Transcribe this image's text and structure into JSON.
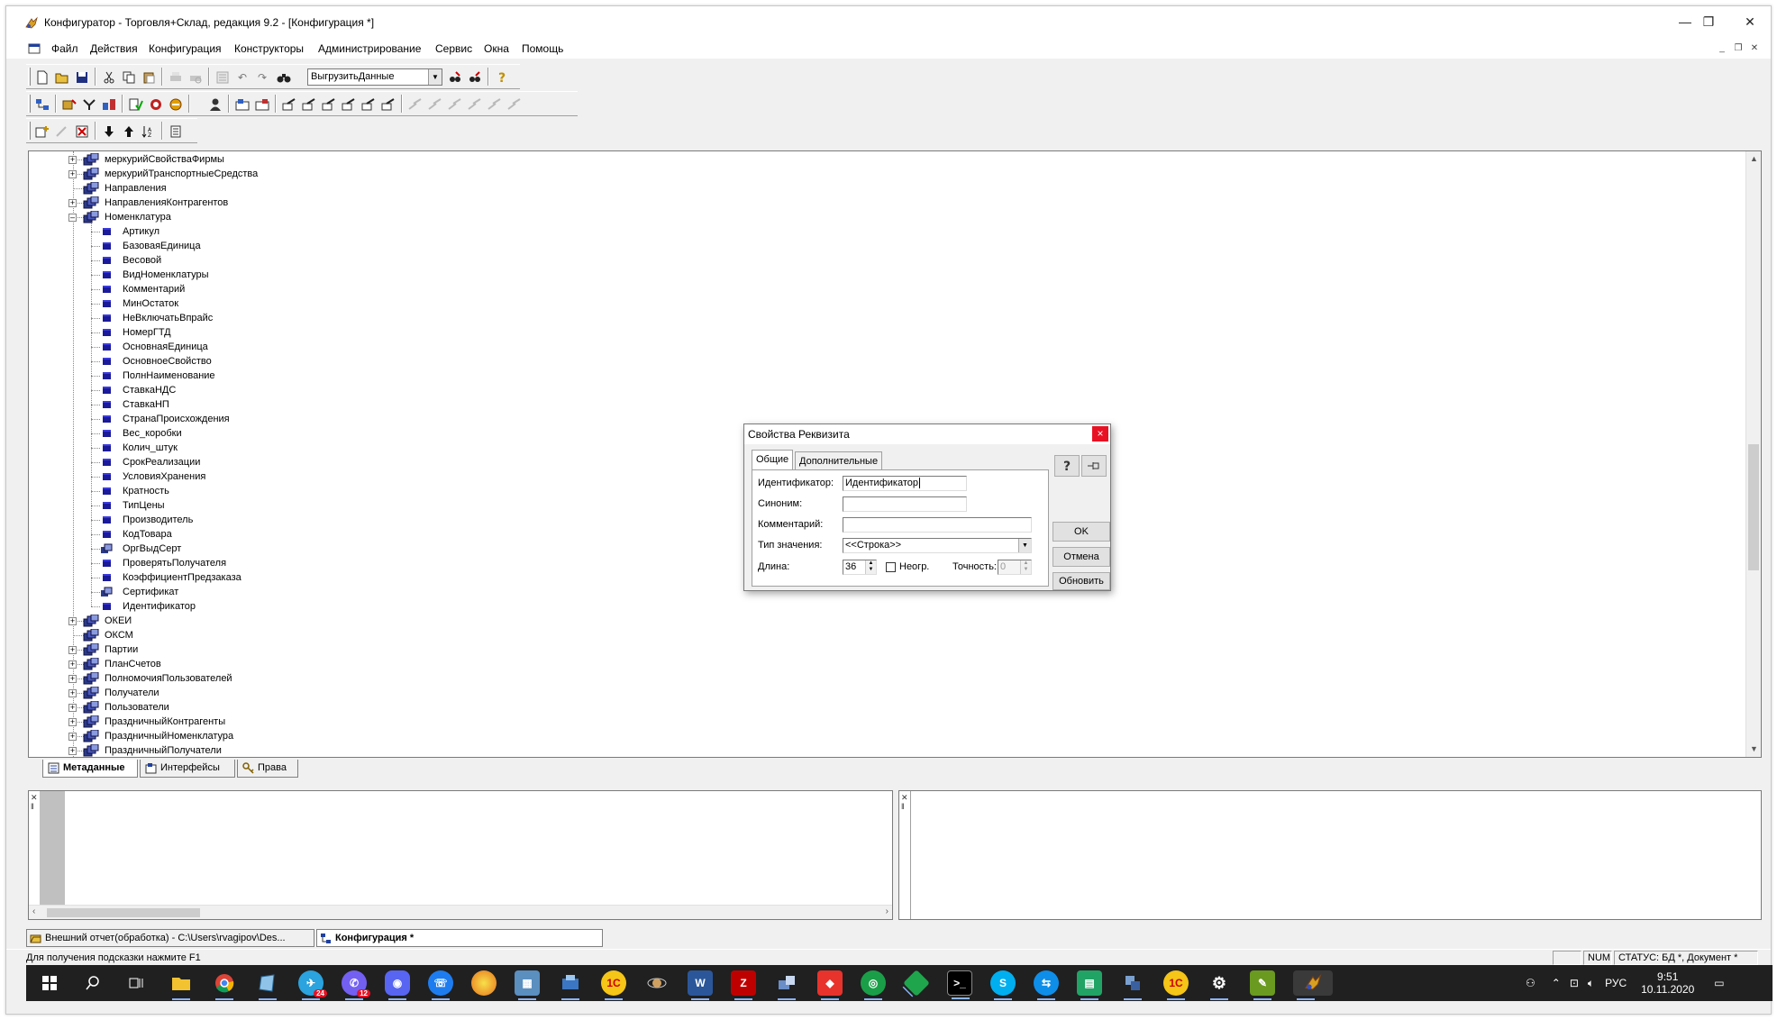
{
  "window": {
    "title": "Конфигуратор - Торговля+Склад, редакция 9.2 - [Конфигурация *]",
    "minimize": "—",
    "maximize": "❐",
    "close": "✕"
  },
  "menu": [
    "Файл",
    "Действия",
    "Конфигурация",
    "Конструкторы",
    "Администрирование",
    "Сервис",
    "Окна",
    "Помощь"
  ],
  "toolbar": {
    "combo_value": "ВыгрузитьДанные"
  },
  "tree": {
    "items": [
      {
        "label": "меркурийСвойстваФирмы",
        "level": 1,
        "expander": "+"
      },
      {
        "label": "меркурийТранспортныеСредства",
        "level": 1,
        "expander": "+"
      },
      {
        "label": "Направления",
        "level": 1,
        "expander": ""
      },
      {
        "label": "НаправленияКонтрагентов",
        "level": 1,
        "expander": "+"
      },
      {
        "label": "Номенклатура",
        "level": 1,
        "expander": "−"
      },
      {
        "label": "Артикул",
        "level": 2
      },
      {
        "label": "БазоваяЕдиница",
        "level": 2
      },
      {
        "label": "Весовой",
        "level": 2
      },
      {
        "label": "ВидНоменклатуры",
        "level": 2
      },
      {
        "label": "Комментарий",
        "level": 2
      },
      {
        "label": "МинОстаток",
        "level": 2
      },
      {
        "label": "НеВключатьВпрайс",
        "level": 2
      },
      {
        "label": "НомерГТД",
        "level": 2
      },
      {
        "label": "ОсновнаяЕдиница",
        "level": 2
      },
      {
        "label": "ОсновноеСвойство",
        "level": 2
      },
      {
        "label": "ПолнНаименование",
        "level": 2
      },
      {
        "label": "СтавкаНДС",
        "level": 2
      },
      {
        "label": "СтавкаНП",
        "level": 2
      },
      {
        "label": "СтранаПроисхождения",
        "level": 2
      },
      {
        "label": "Вес_коробки",
        "level": 2
      },
      {
        "label": "Колич_штук",
        "level": 2
      },
      {
        "label": "СрокРеализации",
        "level": 2
      },
      {
        "label": "УсловияХранения",
        "level": 2
      },
      {
        "label": "Кратность",
        "level": 2
      },
      {
        "label": "ТипЦены",
        "level": 2
      },
      {
        "label": "Производитель",
        "level": 2
      },
      {
        "label": "КодТовара",
        "level": 2
      },
      {
        "label": "ОргВыдСерт",
        "level": 2,
        "alt": true
      },
      {
        "label": "ПроверятьПолучателя",
        "level": 2
      },
      {
        "label": "КоэффициентПредзаказа",
        "level": 2
      },
      {
        "label": "Сертификат",
        "level": 2,
        "alt": true
      },
      {
        "label": "Идентификатор",
        "level": 2
      },
      {
        "label": "ОКЕИ",
        "level": 1,
        "expander": "+"
      },
      {
        "label": "ОКСМ",
        "level": 1,
        "expander": ""
      },
      {
        "label": "Партии",
        "level": 1,
        "expander": "+"
      },
      {
        "label": "ПланСчетов",
        "level": 1,
        "expander": "+"
      },
      {
        "label": "ПолномочияПользователей",
        "level": 1,
        "expander": "+"
      },
      {
        "label": "Получатели",
        "level": 1,
        "expander": "+"
      },
      {
        "label": "Пользователи",
        "level": 1,
        "expander": "+"
      },
      {
        "label": "ПраздничныйКонтрагенты",
        "level": 1,
        "expander": "+"
      },
      {
        "label": "ПраздничныйНоменклатура",
        "level": 1,
        "expander": "+"
      },
      {
        "label": "ПраздничныйПолучатели",
        "level": 1,
        "expander": "+"
      }
    ]
  },
  "tree_tabs": [
    {
      "label": "Метаданные",
      "active": true
    },
    {
      "label": "Интерфейсы",
      "active": false
    },
    {
      "label": "Права",
      "active": false
    }
  ],
  "window_tabs": [
    {
      "label": "Внешний отчет(обработка) - C:\\Users\\rvagipov\\Des...",
      "active": false
    },
    {
      "label": "Конфигурация *",
      "active": true
    }
  ],
  "status": {
    "hint": "Для получения подсказки нажмите F1",
    "num": "NUM",
    "db_status": "СТАТУС: БД *, Документ *"
  },
  "dialog": {
    "title": "Свойства Реквизита",
    "close": "×",
    "tabs": [
      "Общие",
      "Дополнительные"
    ],
    "fields": {
      "identifier_label": "Идентификатор:",
      "identifier_value": "Идентификатор",
      "synonym_label": "Синоним:",
      "synonym_value": "",
      "comment_label": "Комментарий:",
      "comment_value": "",
      "type_label": "Тип значения:",
      "type_value": "<<Строка>>",
      "length_label": "Длина:",
      "length_value": "36",
      "unlimited_label": "Неогр.",
      "precision_label": "Точность:",
      "precision_value": "0"
    },
    "buttons": {
      "ok": "OK",
      "cancel": "Отмена",
      "refresh": "Обновить"
    }
  },
  "taskbar": {
    "lang": "РУС",
    "time": "9:51",
    "date": "10.11.2020",
    "telegram_badge": "24",
    "viber_badge": "12"
  }
}
